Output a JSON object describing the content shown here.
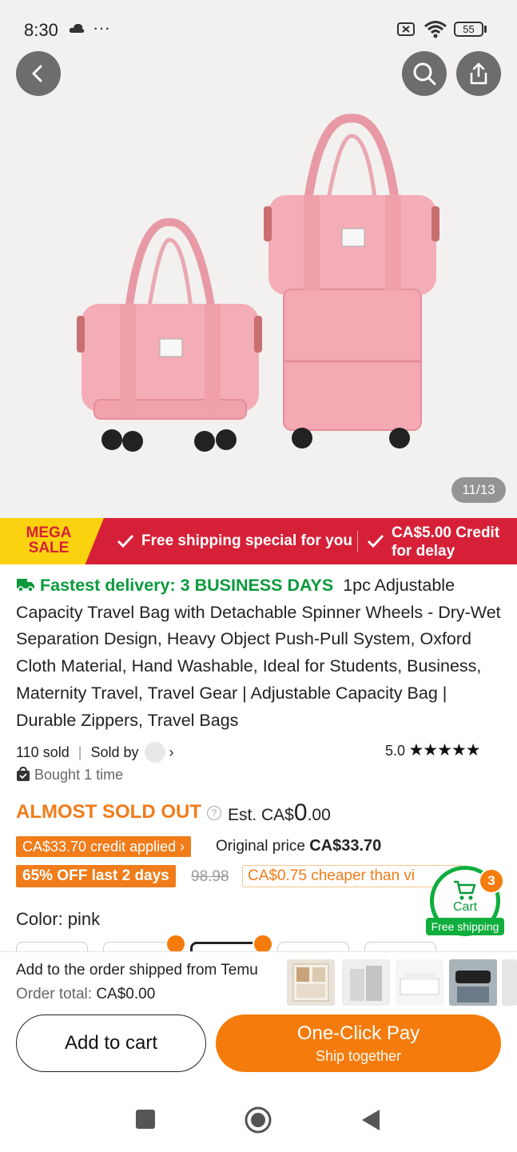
{
  "status_bar": {
    "time": "8:30",
    "dots": "···",
    "battery": "55"
  },
  "hero": {
    "image_counter": "11/13",
    "icons": [
      "back-arrow-icon",
      "search-icon",
      "share-icon"
    ]
  },
  "banner": {
    "mega_line1": "MEGA",
    "mega_line2": "SALE",
    "free_shipping": "Free shipping special for you",
    "credit_line1": "CA$5.00 Credit",
    "credit_line2": "for delay"
  },
  "product": {
    "fastest": "Fastest delivery: 3 BUSINESS DAYS",
    "title": "1pc Adjustable Capacity Travel Bag with Detachable Spinner Wheels - Dry-Wet Separation Design, Heavy Object Push-Pull System, Oxford Cloth Material, Hand Washable, Ideal for Students, Business, Maternity Travel, Travel Gear | Adjustable Capacity Bag | Durable Zippers, Travel Bags",
    "sold": "110 sold",
    "sold_by": "Sold by",
    "rating": "5.0",
    "bought": "Bought 1 time"
  },
  "pricing": {
    "almost_sold_out": "ALMOST SOLD OUT",
    "est_prefix": "Est. CA$",
    "est_big": "0",
    "est_suffix": ".00",
    "credit_applied": "CA$33.70 credit applied",
    "original_label": "Original price",
    "original_value": "CA$33.70",
    "discount": "65% OFF last 2 days",
    "strike_price": "98.98",
    "cheaper": "CA$0.75 cheaper than vi"
  },
  "floating_cart": {
    "count": "3",
    "label": "Cart",
    "free_shipping": "Free shipping"
  },
  "color": {
    "label": "Color: pink"
  },
  "bottom_sheet": {
    "add_order": "Add to the order shipped from Temu",
    "order_total_label": "Order total:",
    "order_total_value": "CA$0.00",
    "add_to_cart": "Add to cart",
    "one_click": "One-Click Pay",
    "ship_together": "Ship together"
  },
  "colors": {
    "accent_orange": "#f07c1a",
    "banner_red": "#d62038",
    "mega_yellow": "#fbd20f",
    "green": "#0b9a3c",
    "bag_pink": "#f2a2ad"
  }
}
